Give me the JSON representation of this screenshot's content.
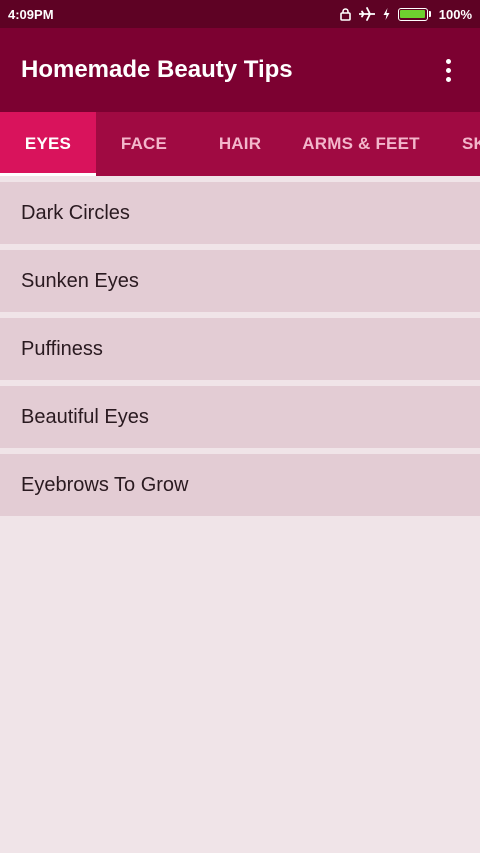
{
  "status_bar": {
    "time": "4:09PM",
    "battery_percent": "100%",
    "battery_level": 1.0,
    "icons": [
      "lock-icon",
      "airplane-icon",
      "charging-bolt-icon",
      "battery-icon"
    ]
  },
  "app_bar": {
    "title": "Homemade Beauty Tips",
    "overflow_icon": "more-vert-icon"
  },
  "tabs": [
    {
      "label": "EYES",
      "active": true
    },
    {
      "label": "FACE",
      "active": false
    },
    {
      "label": "HAIR",
      "active": false
    },
    {
      "label": "ARMS & FEET",
      "active": false
    },
    {
      "label": "SK",
      "active": false
    }
  ],
  "list": {
    "items": [
      {
        "label": "Dark Circles"
      },
      {
        "label": "Sunken Eyes"
      },
      {
        "label": "Puffiness"
      },
      {
        "label": "Beautiful Eyes"
      },
      {
        "label": "Eyebrows To Grow"
      }
    ]
  },
  "colors": {
    "status_bar": "#5e0224",
    "app_bar": "#7c0131",
    "tab_bar": "#a00a42",
    "tab_active": "#d9135c",
    "list_item_bg": "#e3ccd4",
    "page_bg": "#f0e4e8"
  }
}
